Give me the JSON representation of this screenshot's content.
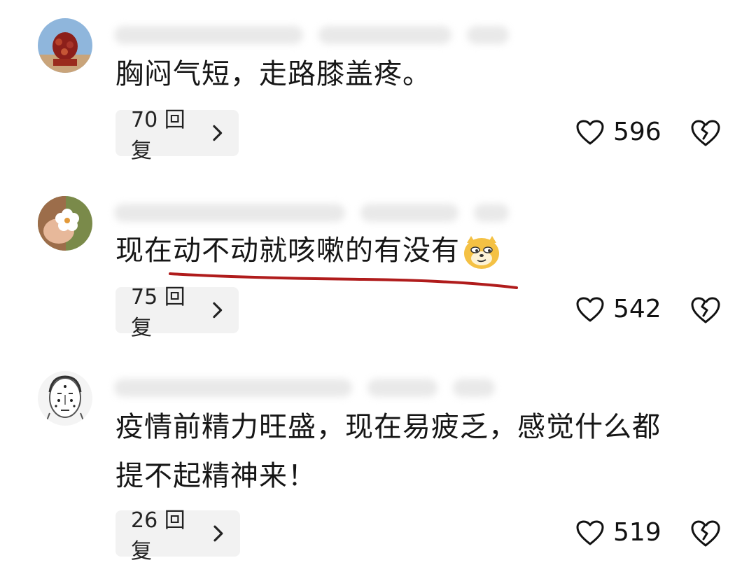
{
  "comments": [
    {
      "text": "胸闷气短，走路膝盖疼。",
      "reply_label": "70 回复",
      "likes": "596",
      "avatar": "red-planter-avatar"
    },
    {
      "text": "现在动不动就咳嗽的有没有",
      "reply_label": "75 回复",
      "likes": "542",
      "avatar": "white-flower-avatar",
      "emoji": "doge-emoji"
    },
    {
      "text_line1": "疫情前精力旺盛，现在易疲乏，感觉什么都",
      "text_line2": "提不起精神来！",
      "reply_label": "26 回复",
      "likes": "519",
      "avatar": "face-diagram-avatar"
    }
  ],
  "colors": {
    "reply_bg": "#f2f2f2",
    "underline": "#b01c1c",
    "text": "#161616"
  },
  "icons": [
    "heart-outline-icon",
    "broken-heart-icon",
    "chevron-right-icon"
  ]
}
